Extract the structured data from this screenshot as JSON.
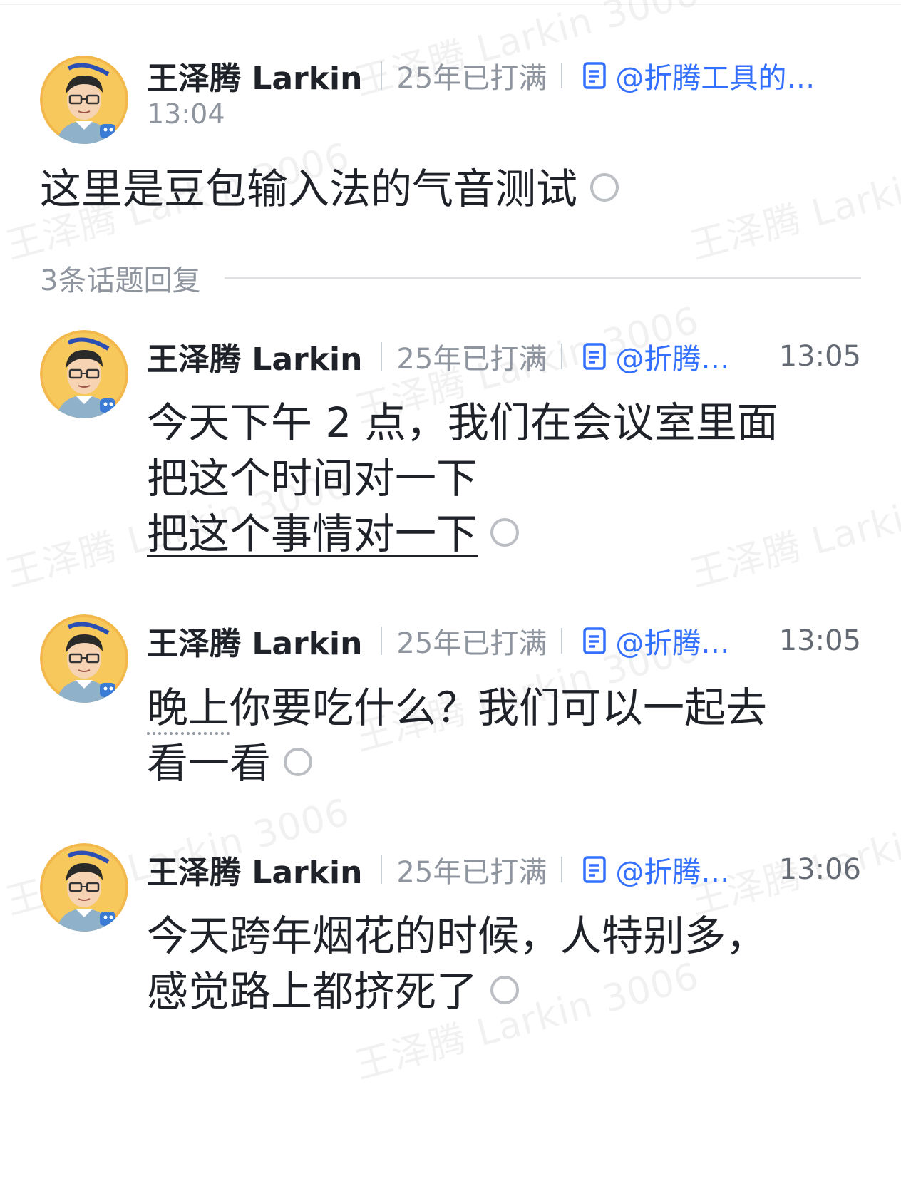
{
  "watermark": "王泽腾 Larkin 3006",
  "root": {
    "author": "王泽腾 Larkin",
    "signature": "25年已打满",
    "doc_link": "@折腾工具的泽...",
    "time": "13:04",
    "text": "这里是豆包输入法的气音测试"
  },
  "thread": {
    "label": "3条话题回复"
  },
  "replies": [
    {
      "author": "王泽腾 Larkin",
      "signature": "25年已打满",
      "doc_link": "@折腾工...",
      "time": "13:05",
      "lines": [
        "今天下午 2 点，我们在会议室里面",
        "把这个时间对一下",
        "把这个事情对一下"
      ]
    },
    {
      "author": "王泽腾 Larkin",
      "signature": "25年已打满",
      "doc_link": "@折腾工...",
      "time": "13:05",
      "line1_underlined": "晚上",
      "line1_rest": "你要吃什么？我们可以一起去",
      "line2": "看一看"
    },
    {
      "author": "王泽腾 Larkin",
      "signature": "25年已打满",
      "doc_link": "@折腾工...",
      "time": "13:06",
      "lines": [
        "今天跨年烟花的时候，人特别多，",
        "感觉路上都挤死了"
      ]
    }
  ],
  "icons": {
    "doc": "doc-icon",
    "status": "read-status-icon",
    "avatar": "avatar"
  },
  "colors": {
    "link": "#3370ff",
    "muted": "#8f959e",
    "text": "#1f2329"
  }
}
